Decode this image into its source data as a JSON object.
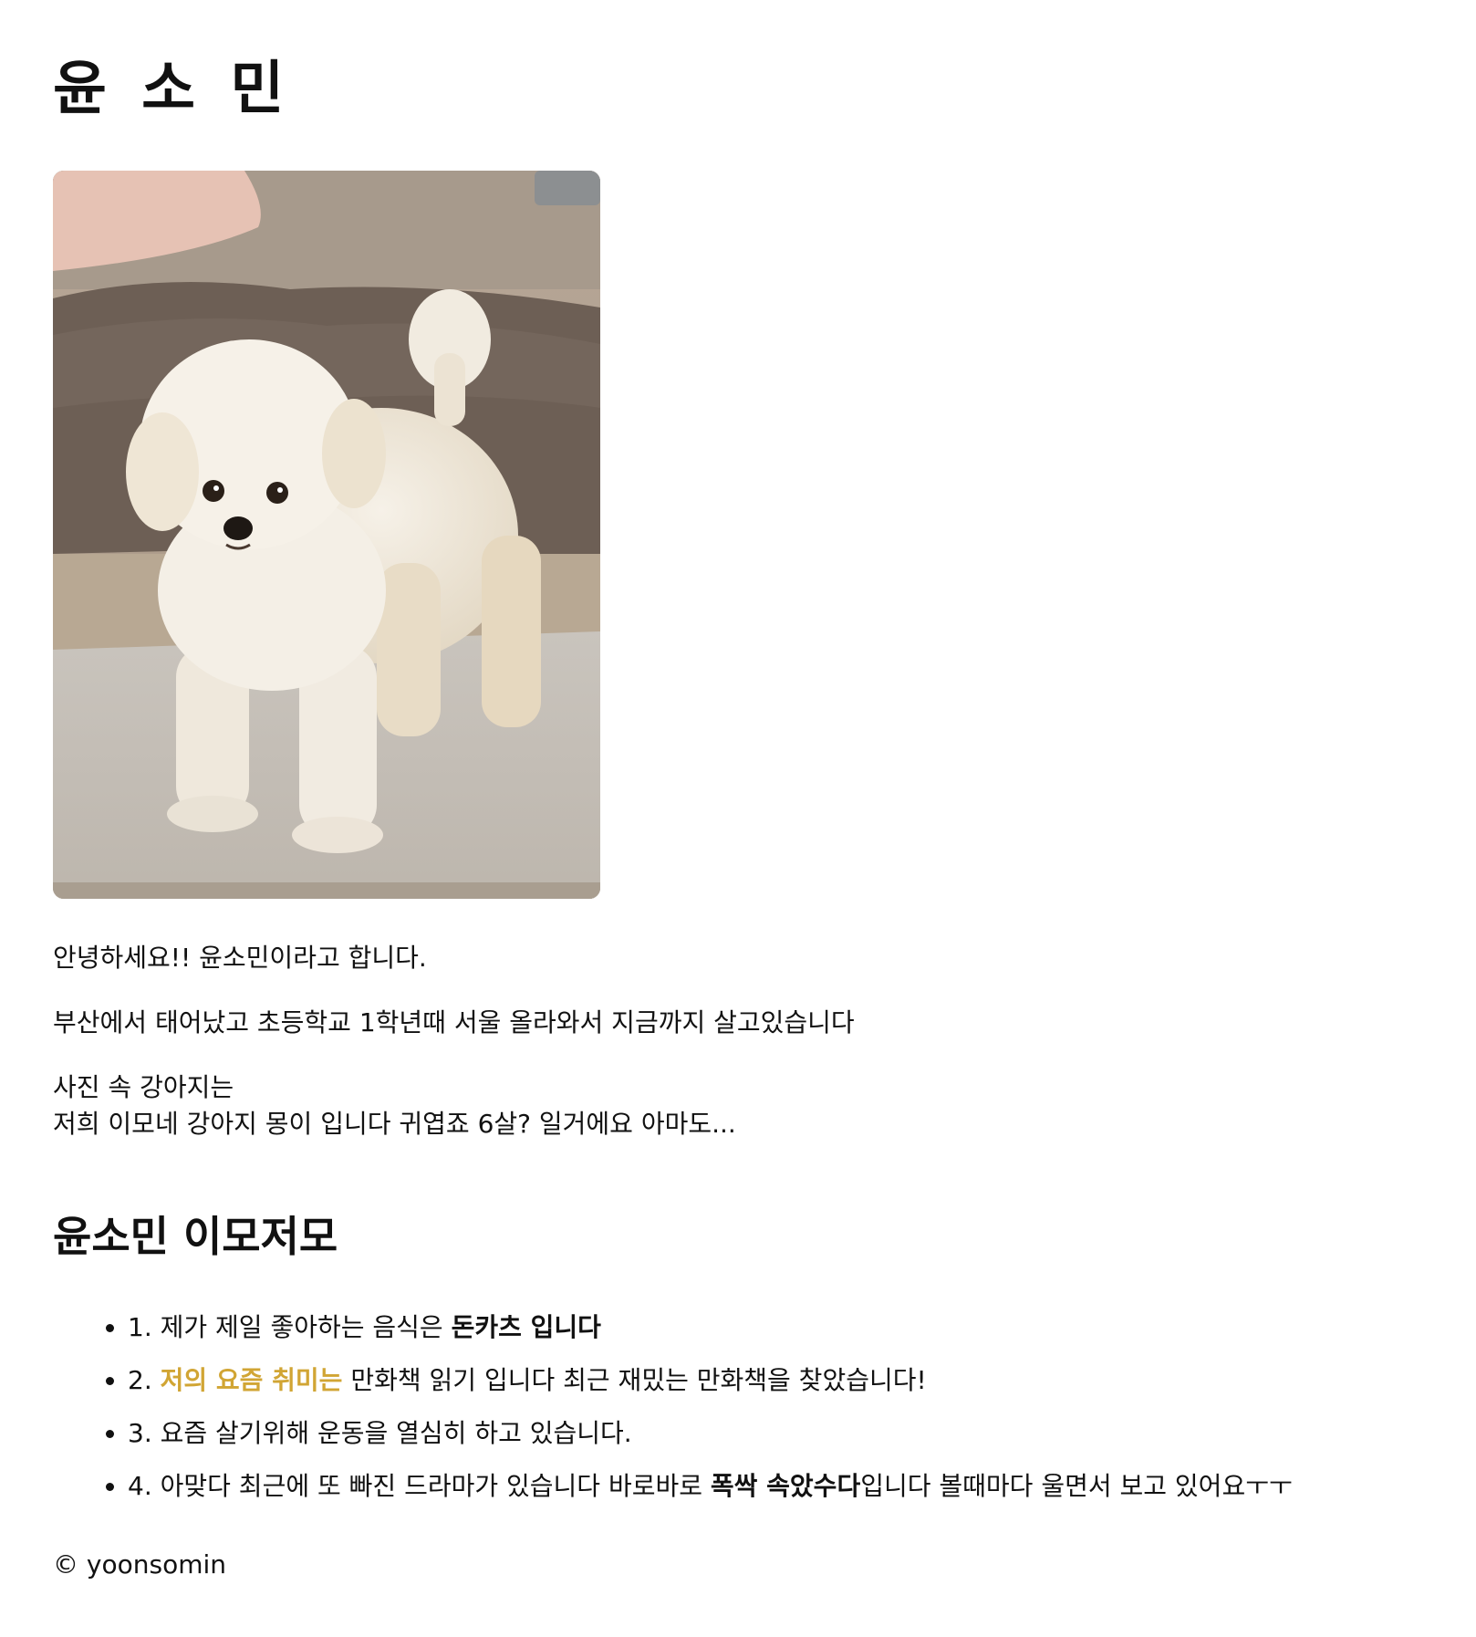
{
  "header": {
    "title": "윤 소 민"
  },
  "photo": {
    "subject": "dog-photo"
  },
  "intro": {
    "p1": "안녕하세요!! 윤소민이라고 합니다.",
    "p2": "부산에서 태어났고 초등학교 1학년때 서울 올라와서 지금까지 살고있습니다",
    "p3_line1": "사진 속 강아지는",
    "p3_line2": "저희 이모네 강아지 몽이 입니다 귀엽죠 6살? 일거에요 아마도..."
  },
  "section": {
    "title": "윤소민 이모저모"
  },
  "facts": [
    {
      "num": "1. ",
      "pre": "제가 제일 좋아하는 음식은 ",
      "strong": "돈카츠 입니다",
      "post": ""
    },
    {
      "num": "2. ",
      "accent": "저의 요즘 취미는",
      "post": " 만화책 읽기 입니다 최근 재밌는 만화책을 찾았습니다!"
    },
    {
      "num": "3. ",
      "text": "요즘 살기위해 운동을 열심히 하고 있습니다."
    },
    {
      "num": "4. ",
      "pre": "아맞다 최근에 또 빠진 드라마가 있습니다 바로바로 ",
      "strong": "폭싹 속았수다",
      "post": "입니다 볼때마다 울면서 보고 있어요ㅜㅜ"
    }
  ],
  "footer": {
    "text": "© yoonsomin"
  },
  "colors": {
    "accent": "#d1a534",
    "text": "#111111",
    "background": "#ffffff"
  }
}
